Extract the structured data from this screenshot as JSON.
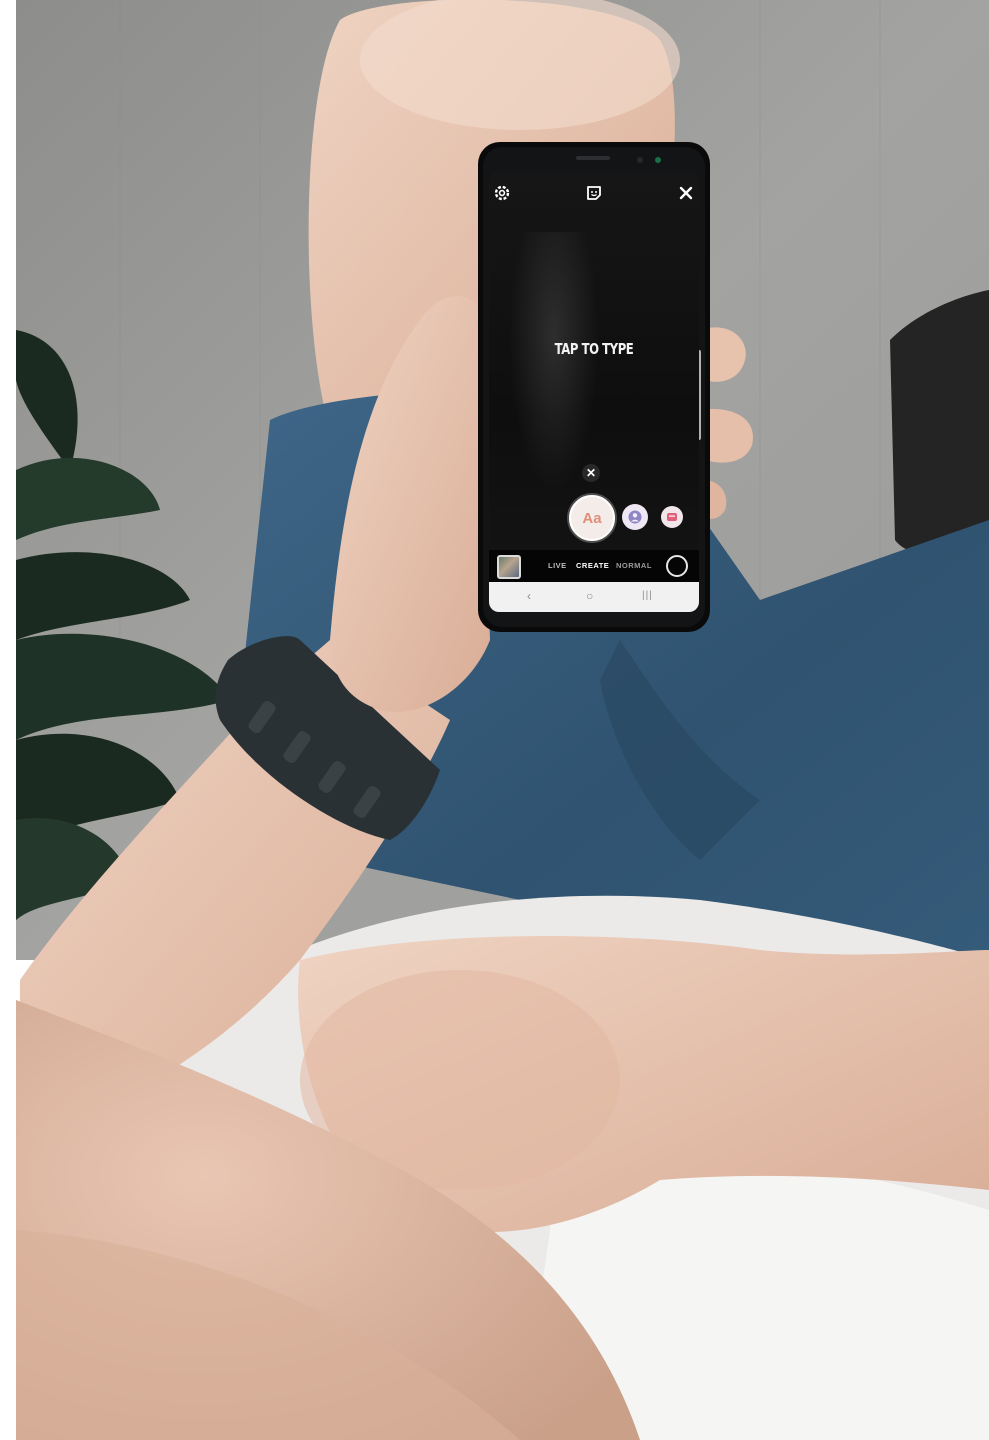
{
  "screen": {
    "prompt_text": "TAP TO TYPE",
    "text_mode_label": "Aa",
    "modes": {
      "live": "LIVE",
      "create": "CREATE",
      "normal": "NORMAL"
    },
    "selected_mode": "CREATE",
    "icons": {
      "settings": "gear-icon",
      "sticker": "sticker-icon",
      "close": "close-icon",
      "dismiss": "close-icon",
      "face_mode": "person-icon",
      "gif_mode": "gif-icon",
      "nav_back": "chevron-left-icon",
      "nav_home": "home-circle-icon",
      "nav_recent": "recent-apps-icon"
    },
    "nav": {
      "back": "‹",
      "home": "○",
      "recent": "|||"
    },
    "colors": {
      "text_mode_accent": "#e08f7a",
      "screen_background": "#111111"
    }
  }
}
